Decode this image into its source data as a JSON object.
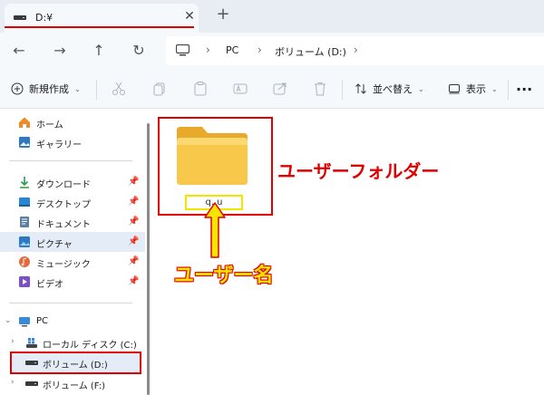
{
  "tab": {
    "title": "D:¥",
    "close_glyph": "✕",
    "new_tab_glyph": "+"
  },
  "nav": {
    "back": "←",
    "forward": "→",
    "up": "↑",
    "refresh": "↻"
  },
  "address": {
    "segments": [
      "PC",
      "ボリューム (D:)"
    ],
    "separator": "›"
  },
  "toolbar": {
    "new_label": "新規作成",
    "sort_label": "並べ替え",
    "view_label": "表示",
    "more_glyph": "···"
  },
  "sidebar": {
    "home": "ホーム",
    "gallery": "ギャラリー",
    "quick": [
      "ダウンロード",
      "デスクトップ",
      "ドキュメント",
      "ピクチャ",
      "ミュージック",
      "ビデオ"
    ],
    "pc": "PC",
    "drives": [
      "ローカル ディスク (C:)",
      "ボリューム (D:)",
      "ボリューム (F:)"
    ]
  },
  "content": {
    "folder_name": "q..u",
    "callout_folder": "ユーザーフォルダー",
    "callout_username": "ユーザー名"
  },
  "colors": {
    "accent_red": "#e00000",
    "accent_yellow": "#f5e300",
    "folder_yellow": "#f8c84a",
    "selected_bg": "#e4edf7"
  }
}
